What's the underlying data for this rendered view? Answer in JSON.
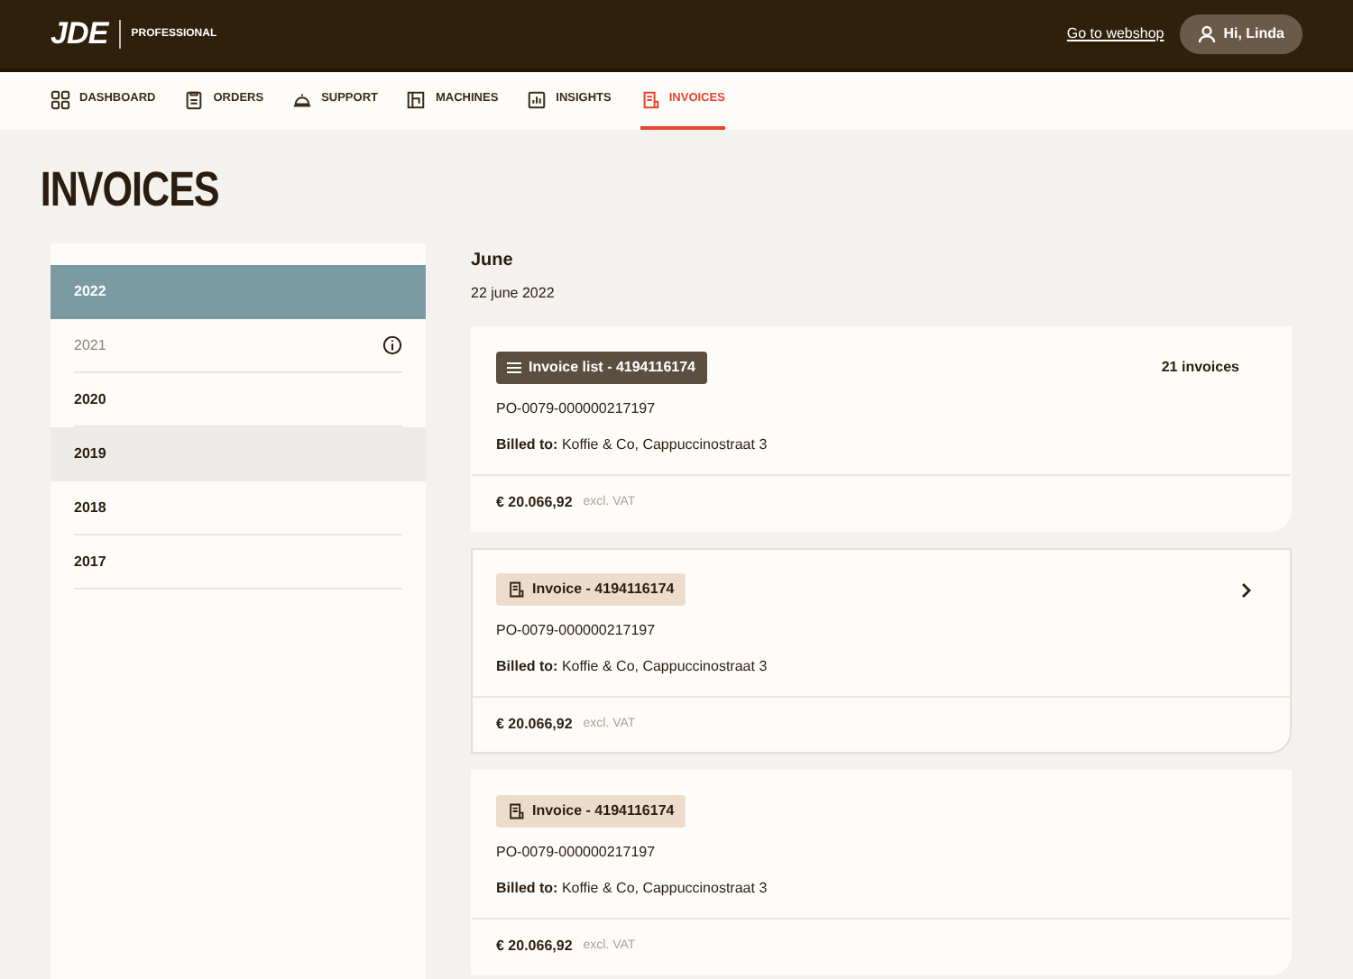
{
  "header": {
    "logo": "JDE",
    "logo_sub": "PROFESSIONAL",
    "webshop_link": "Go to webshop",
    "user_button": "Hi, Linda"
  },
  "nav": [
    {
      "label": "DASHBOARD",
      "selected": false
    },
    {
      "label": "ORDERS",
      "selected": false
    },
    {
      "label": "SUPPORT",
      "selected": false
    },
    {
      "label": "MACHINES",
      "selected": false
    },
    {
      "label": "INSIGHTS",
      "selected": false
    },
    {
      "label": "INVOICES",
      "selected": true
    }
  ],
  "title": "INVOICES",
  "years": [
    {
      "label": "2022",
      "selected": true,
      "disabled": false,
      "hovered": false,
      "info": false
    },
    {
      "label": "2021",
      "selected": false,
      "disabled": true,
      "hovered": false,
      "info": true
    },
    {
      "label": "2020",
      "selected": false,
      "disabled": false,
      "hovered": false,
      "info": false
    },
    {
      "label": "2019",
      "selected": false,
      "disabled": false,
      "hovered": true,
      "info": false
    },
    {
      "label": "2018",
      "selected": false,
      "disabled": false,
      "hovered": false,
      "info": false
    },
    {
      "label": "2017",
      "selected": false,
      "disabled": false,
      "hovered": false,
      "info": false
    }
  ],
  "month": "June",
  "date": "22 june 2022",
  "cards": [
    {
      "kind": "list",
      "tag": "Invoice list - 4194116174",
      "count": "21 invoices",
      "po": "PO-0079-000000217197",
      "billed": "**Billed to:** Koffie & Co, Cappuccinostraat 3",
      "amount": "€ 20.066,92",
      "vat": "excl. VAT",
      "hovered": false
    },
    {
      "kind": "invoice",
      "tag": "Invoice - 4194116174",
      "po": "PO-0079-000000217197",
      "billed": "**Billed to:** Koffie & Co, Cappuccinostraat 3",
      "amount": "€ 20.066,92",
      "vat": "excl. VAT",
      "hovered": true
    },
    {
      "kind": "invoice",
      "tag": "Invoice - 4194116174",
      "po": "PO-0079-000000217197",
      "billed": "**Billed to:** Koffie & Co, Cappuccinostraat 3",
      "amount": "€ 20.066,92",
      "vat": "excl. VAT",
      "hovered": false
    }
  ]
}
